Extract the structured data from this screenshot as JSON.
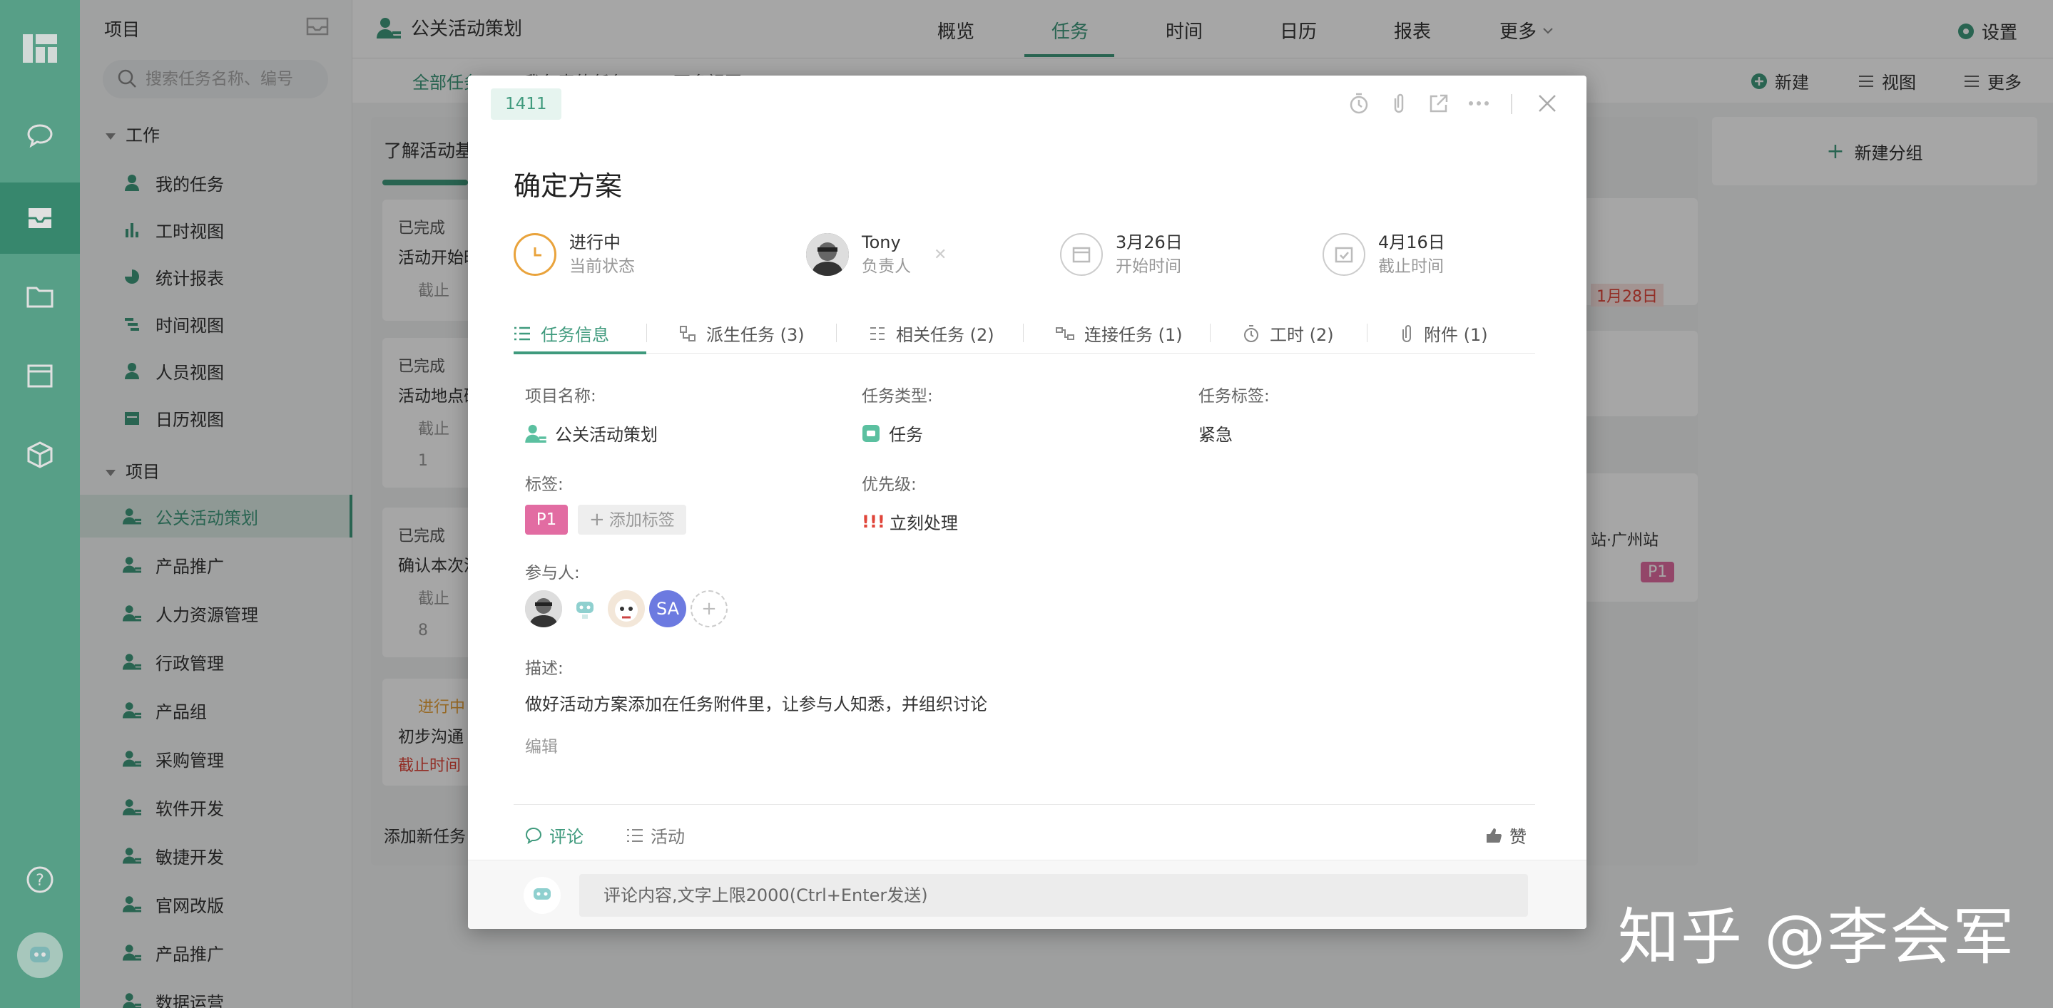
{
  "sidebar": {
    "title": "项目",
    "search_placeholder": "搜索任务名称、编号",
    "work_section": "工作",
    "work_items": [
      "我的任务",
      "工时视图",
      "统计报表",
      "时间视图",
      "人员视图",
      "日历视图"
    ],
    "project_section": "项目",
    "projects": [
      "公关活动策划",
      "产品推广",
      "人力资源管理",
      "行政管理",
      "产品组",
      "采购管理",
      "软件开发",
      "敏捷开发",
      "官网改版",
      "产品推广",
      "数据运营"
    ]
  },
  "topbar": {
    "project_name": "公关活动策划",
    "tabs": [
      "概览",
      "任务",
      "时间",
      "日历",
      "报表",
      "更多"
    ],
    "settings": "设置"
  },
  "subbar": {
    "filters": [
      "全部任务",
      "我负责的任务",
      "更多视图"
    ],
    "new": "新建",
    "view": "视图",
    "more": "更多"
  },
  "board": {
    "col1_title": "了解活动基本要求",
    "status_done": "已完成",
    "status_doing": "进行中",
    "cards": [
      "活动开始时间",
      "活动地点确认",
      "确认本次活动",
      "初步沟通"
    ],
    "deadline": "截止时间",
    "deadline_short": "截止",
    "attach_count_1": "1",
    "attach_count_2": "8",
    "add_task": "添加新任务",
    "new_group": "新建分组",
    "date_red": "1月28日",
    "station": "站·广州站",
    "p1": "P1"
  },
  "modal": {
    "id": "1411",
    "title": "确定方案",
    "status": {
      "value": "进行中",
      "label": "当前状态"
    },
    "owner": {
      "value": "Tony",
      "label": "负责人"
    },
    "start": {
      "value": "3月26日",
      "label": "开始时间"
    },
    "due": {
      "value": "4月16日",
      "label": "截止时间"
    },
    "tabs": [
      "任务信息",
      "派生任务 (3)",
      "相关任务 (2)",
      "连接任务 (1)",
      "工时 (2)",
      "附件 (1)"
    ],
    "fields": {
      "project_label": "项目名称:",
      "project_value": "公关活动策划",
      "type_label": "任务类型:",
      "type_value": "任务",
      "tasktag_label": "任务标签:",
      "tasktag_value": "紧急",
      "tags_label": "标签:",
      "tag_p1": "P1",
      "add_tag": "添加标签",
      "priority_label": "优先级:",
      "priority_marks": "!!!",
      "priority_value": "立刻处理",
      "participants_label": "参与人:",
      "participant_sa": "SA",
      "desc_label": "描述:",
      "desc_value": "做好活动方案添加在任务附件里，让参与人知悉，并组织讨论",
      "edit": "编辑"
    },
    "bottom_tabs": {
      "comment": "评论",
      "activity": "活动",
      "like": "赞"
    },
    "comment_placeholder": "评论内容,文字上限2000(Ctrl+Enter发送)"
  },
  "watermark": "知乎 @李会军",
  "colors": {
    "brand": "#3f9a7d",
    "rail": "#63b59a",
    "orange": "#e9a33c",
    "pink": "#e26ca2",
    "red": "#e0453a"
  }
}
